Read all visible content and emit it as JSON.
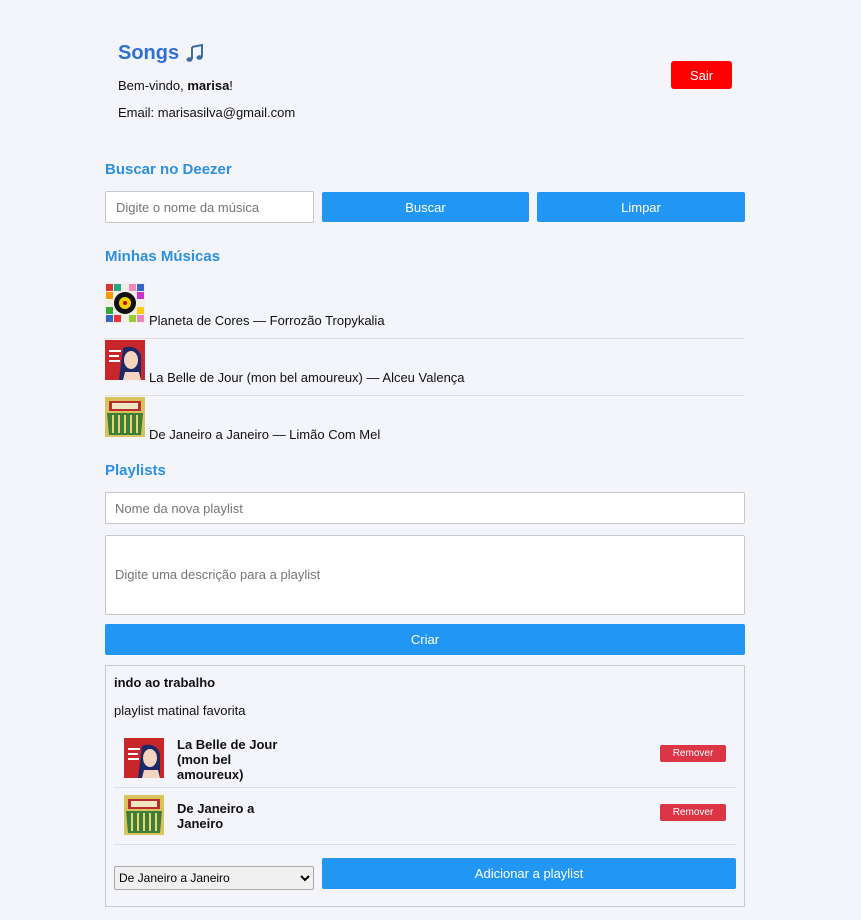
{
  "header": {
    "title": "Songs",
    "welcome_prefix": "Bem-vindo, ",
    "username": "marisa",
    "welcome_suffix": "!",
    "email_label": "Email: ",
    "email": "marisasilva@gmail.com",
    "logout_label": "Sair"
  },
  "search": {
    "section_title": "Buscar no Deezer",
    "placeholder": "Digite o nome da música",
    "search_label": "Buscar",
    "clear_label": "Limpar"
  },
  "my_songs": {
    "section_title": "Minhas Músicas",
    "items": [
      {
        "text": "Planeta de Cores — Forrozão Tropykalia",
        "cover_icon": "album-cover-planeta-de-cores"
      },
      {
        "text": "La Belle de Jour (mon bel amoureux) — Alceu Valença",
        "cover_icon": "album-cover-la-belle-de-jour"
      },
      {
        "text": "De Janeiro a Janeiro — Limão Com Mel",
        "cover_icon": "album-cover-de-janeiro-a-janeiro"
      }
    ]
  },
  "playlists": {
    "section_title": "Playlists",
    "name_placeholder": "Nome da nova playlist",
    "description_placeholder": "Digite uma descrição para a playlist",
    "create_label": "Criar",
    "list": [
      {
        "title": "indo ao trabalho",
        "description": "playlist matinal favorita",
        "songs": [
          {
            "title": "La Belle de Jour (mon bel amoureux)",
            "remove_label": "Remover"
          },
          {
            "title": "De Janeiro a Janeiro",
            "remove_label": "Remover"
          }
        ],
        "selected_song": "De Janeiro a Janeiro",
        "add_label": "Adicionar a playlist"
      }
    ]
  },
  "colors": {
    "accent_blue": "#2196f3",
    "title_blue": "#2f6fd6",
    "section_blue": "#2d8fe0",
    "logout_red": "#ff0000",
    "remove_red": "#dc3545",
    "background": "#f4f5fa"
  }
}
